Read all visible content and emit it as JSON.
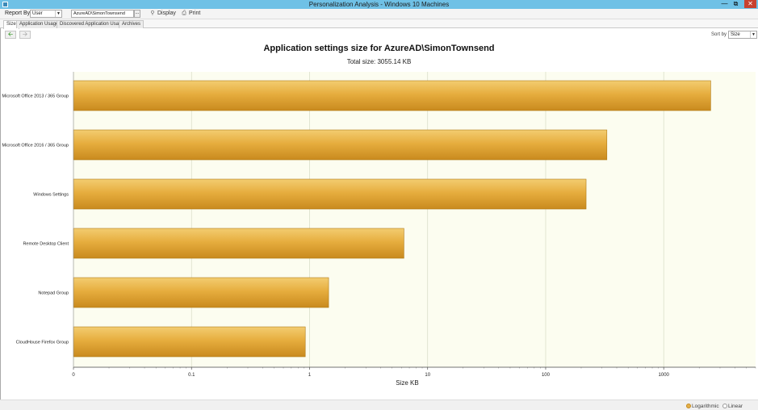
{
  "window": {
    "title": "Personalization Analysis - Windows 10 Machines",
    "controls": [
      "minimize",
      "restore",
      "close"
    ]
  },
  "toolbar": {
    "report_by_label": "Report By",
    "report_by_value": "User",
    "user_value": "AzureAD\\SimonTownsend",
    "browse_label": "...",
    "display_label": "Display",
    "print_label": "Print"
  },
  "tabs": [
    {
      "label": "Size",
      "active": true
    },
    {
      "label": "Application Usage",
      "active": false
    },
    {
      "label": "Discovered Application Usage",
      "active": false
    },
    {
      "label": "Archives",
      "active": false
    }
  ],
  "nav": {
    "sort_by_label": "Sort by",
    "sort_by_value": "Size"
  },
  "chart_data": {
    "type": "bar",
    "orientation": "horizontal",
    "title": "Application settings size for AzureAD\\SimonTownsend",
    "subtitle": "Total size: 3055.14 KB",
    "xlabel": "Size KB",
    "ylabel": "",
    "xscale": "log",
    "xlim": [
      0.01,
      6000
    ],
    "xticks": [
      "0",
      "0.1",
      "1",
      "10",
      "100",
      "1000"
    ],
    "categories": [
      "Microsoft Office 2013 / 365 Group",
      "Microsoft Office 2016 / 365 Group",
      "Windows Settings",
      "Remote Desktop Client",
      "Notepad Group",
      "CloudHouse Firefox Group"
    ],
    "values": [
      2500,
      330,
      220,
      6.3,
      1.45,
      0.92
    ],
    "bar_color": "#e2a93a",
    "plot_background": "#fcfdf0",
    "grid": true
  },
  "status": {
    "scale_options": [
      {
        "label": "Logarithmic",
        "selected": true
      },
      {
        "label": "Linear",
        "selected": false
      }
    ]
  }
}
